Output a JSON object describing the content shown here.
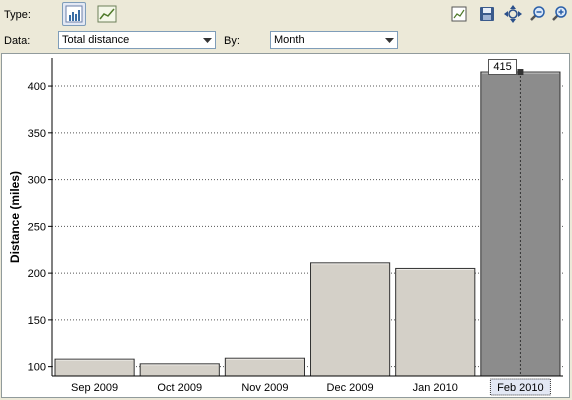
{
  "toolbar": {
    "type_label": "Type:",
    "type_buttons": [
      {
        "icon": "bar-chart-icon",
        "active": true
      },
      {
        "icon": "line-chart-icon",
        "active": false
      }
    ],
    "tools": [
      {
        "icon": "chart-settings-icon"
      },
      {
        "icon": "save-icon"
      },
      {
        "icon": "pan-icon"
      },
      {
        "icon": "zoom-out-icon"
      },
      {
        "icon": "zoom-in-icon"
      }
    ]
  },
  "filters": {
    "data_label": "Data:",
    "data_value": "Total distance",
    "by_label": "By:",
    "by_value": "Month"
  },
  "colors": {
    "bar": "#d4d0c8",
    "bar_selected": "#8c8c8c",
    "grid": "#555555"
  },
  "chart_data": {
    "type": "bar",
    "ylabel": "Distance (miles)",
    "categories": [
      "Sep 2009",
      "Oct 2009",
      "Nov 2009",
      "Dec 2009",
      "Jan 2010",
      "Feb 2010"
    ],
    "values": [
      108,
      103,
      109,
      211,
      205,
      415
    ],
    "ylim": [
      90,
      430
    ],
    "yticks": [
      100,
      150,
      200,
      250,
      300,
      350,
      400
    ],
    "grid": true,
    "selected_index": 5,
    "tooltip": "415"
  }
}
